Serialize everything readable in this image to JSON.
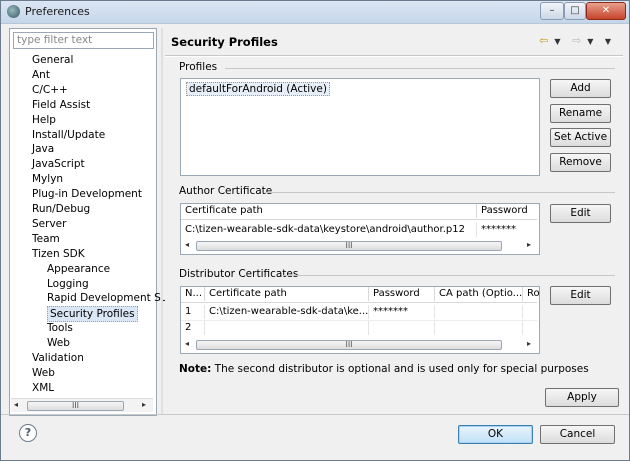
{
  "window": {
    "title": "Preferences"
  },
  "titlebar_buttons": {
    "minimize": "–",
    "maximize": "□",
    "close": "✕"
  },
  "filter": {
    "placeholder": "type filter text"
  },
  "tree": {
    "items": [
      {
        "label": "General",
        "indent": 1
      },
      {
        "label": "Ant",
        "indent": 1
      },
      {
        "label": "C/C++",
        "indent": 1
      },
      {
        "label": "Field Assist",
        "indent": 1
      },
      {
        "label": "Help",
        "indent": 1
      },
      {
        "label": "Install/Update",
        "indent": 1
      },
      {
        "label": "Java",
        "indent": 1
      },
      {
        "label": "JavaScript",
        "indent": 1
      },
      {
        "label": "Mylyn",
        "indent": 1
      },
      {
        "label": "Plug-in Development",
        "indent": 1
      },
      {
        "label": "Run/Debug",
        "indent": 1
      },
      {
        "label": "Server",
        "indent": 1
      },
      {
        "label": "Team",
        "indent": 1
      },
      {
        "label": "Tizen SDK",
        "indent": 1
      },
      {
        "label": "Appearance",
        "indent": 2
      },
      {
        "label": "Logging",
        "indent": 2
      },
      {
        "label": "Rapid Development Su",
        "indent": 2
      },
      {
        "label": "Security Profiles",
        "indent": 2,
        "selected": true
      },
      {
        "label": "Tools",
        "indent": 2
      },
      {
        "label": "Web",
        "indent": 2
      },
      {
        "label": "Validation",
        "indent": 1
      },
      {
        "label": "Web",
        "indent": 1
      },
      {
        "label": "XML",
        "indent": 1
      }
    ]
  },
  "page": {
    "title": "Security Profiles",
    "profiles": {
      "label": "Profiles",
      "items": [
        "defaultForAndroid (Active)"
      ],
      "buttons": {
        "add": "Add",
        "rename": "Rename",
        "set_active": "Set Active",
        "remove": "Remove"
      }
    },
    "author": {
      "label": "Author Certificate",
      "columns": [
        "Certificate path",
        "Password"
      ],
      "row": [
        "C:\\tizen-wearable-sdk-data\\keystore\\android\\author.p12",
        "*******"
      ],
      "edit": "Edit"
    },
    "distributor": {
      "label": "Distributor Certificates",
      "columns": [
        "N...",
        "Certificate path",
        "Password",
        "CA path (Optio...",
        "Ro"
      ],
      "rows": [
        [
          "1",
          "C:\\tizen-wearable-sdk-data\\ke...",
          "*******",
          "",
          ""
        ],
        [
          "2",
          "",
          "",
          "",
          ""
        ]
      ],
      "edit": "Edit"
    },
    "note_bold": "Note:",
    "note": " The second distributor is optional and is used only for special purposes",
    "apply": "Apply"
  },
  "footer": {
    "help": "?",
    "ok": "OK",
    "cancel": "Cancel"
  },
  "scrollbar": {
    "left": "◂",
    "right": "▸",
    "grip": "III"
  }
}
